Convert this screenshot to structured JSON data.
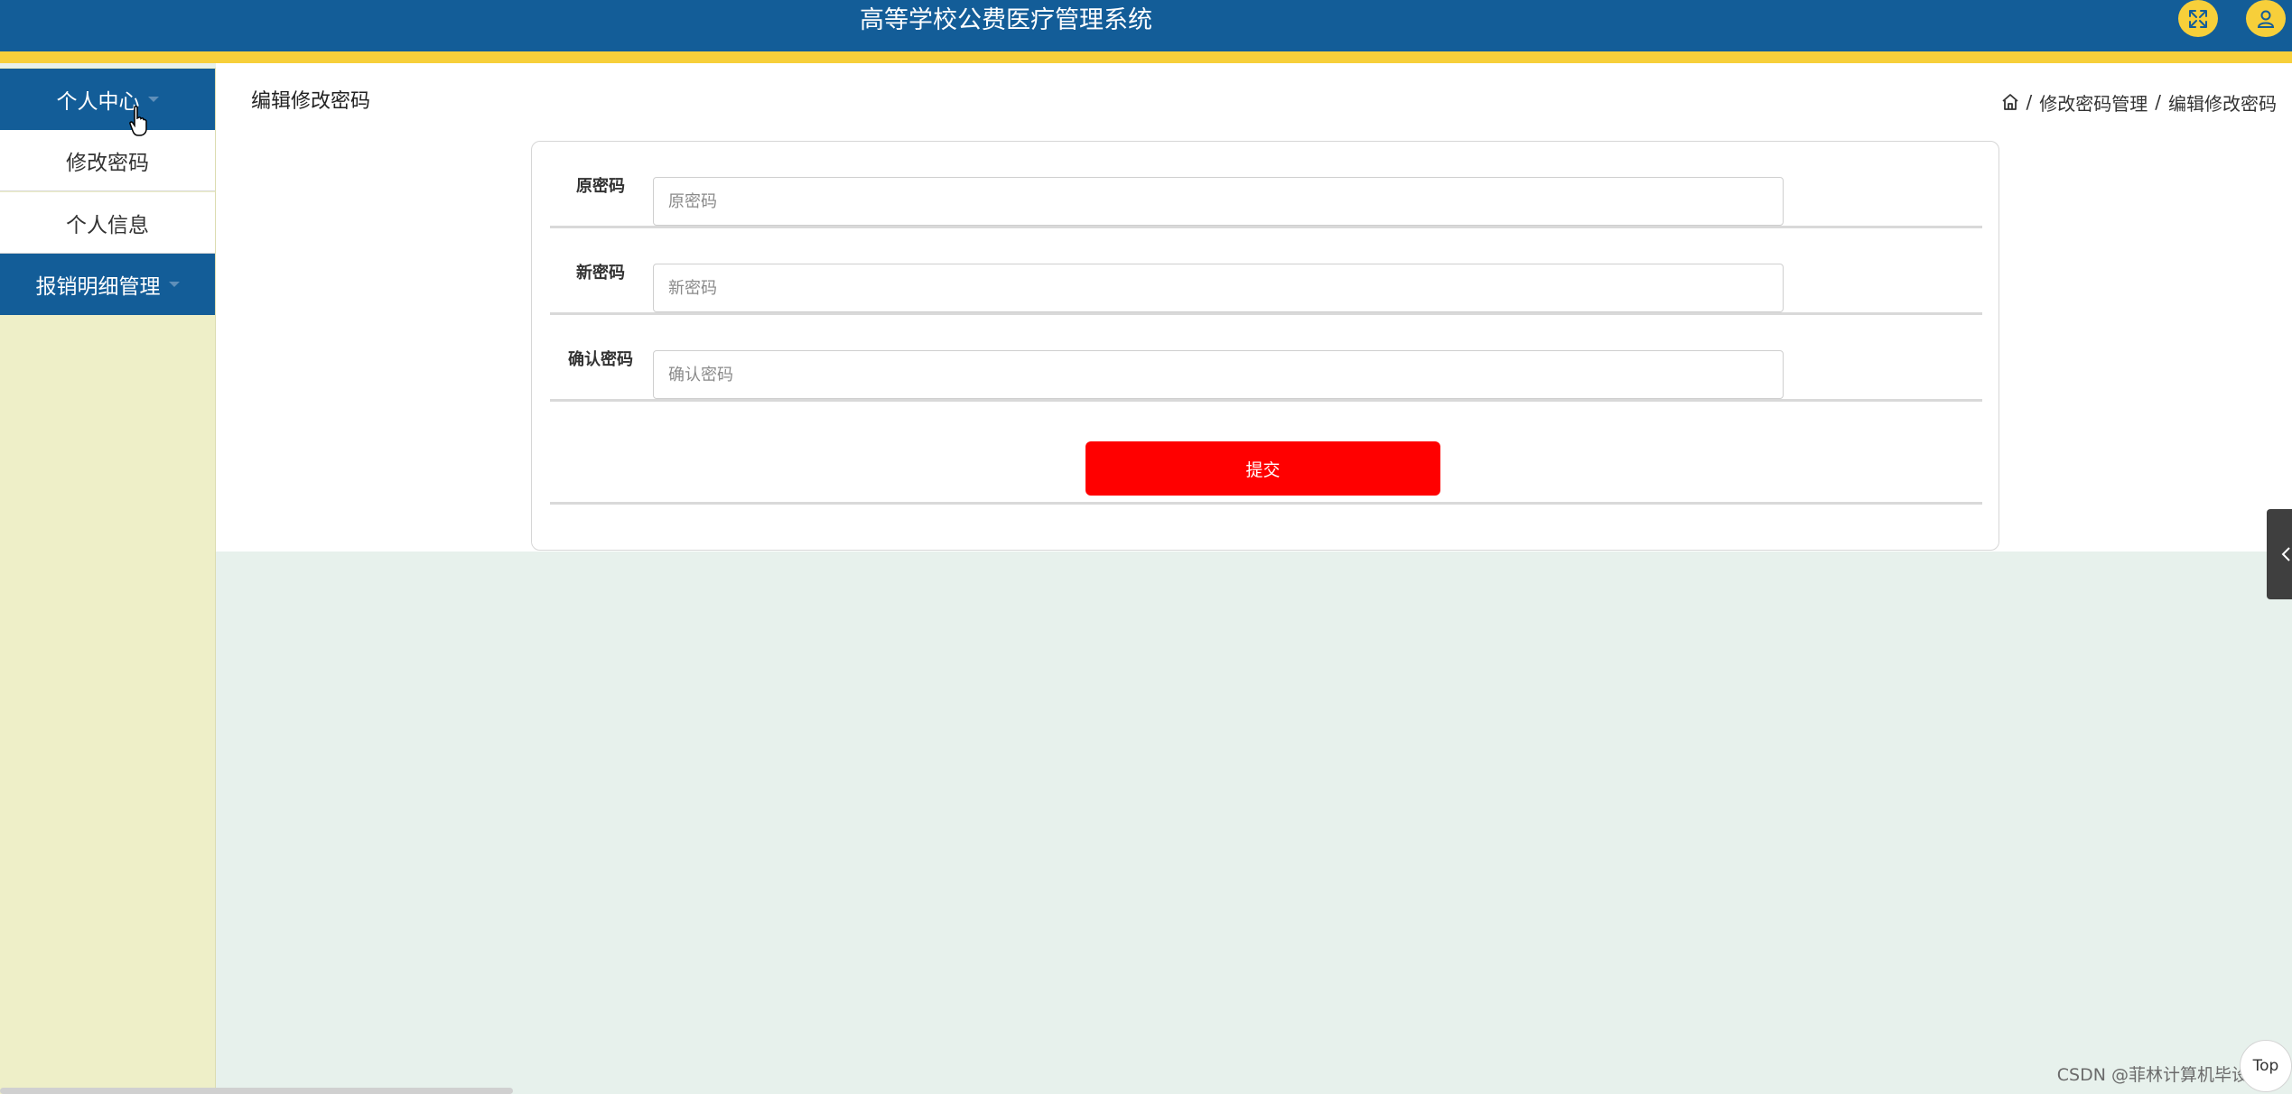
{
  "header": {
    "title": "高等学校公费医疗管理系统",
    "fullscreen_icon": "expand-icon",
    "user_icon": "user-icon",
    "accent_color": "#f7cf3a",
    "bar_color": "#135d98"
  },
  "sidebar": {
    "groups": [
      {
        "label": "个人中心",
        "expanded": true,
        "items": [
          {
            "label": "修改密码"
          },
          {
            "label": "个人信息"
          }
        ]
      },
      {
        "label": "报销明细管理",
        "expanded": false,
        "items": []
      }
    ]
  },
  "main": {
    "page_title": "编辑修改密码",
    "breadcrumb": {
      "home_icon": "home-icon",
      "items": [
        "修改密码管理",
        "编辑修改密码"
      ],
      "separator": "/"
    },
    "form": {
      "fields": [
        {
          "label": "原密码",
          "placeholder": "原密码",
          "value": ""
        },
        {
          "label": "新密码",
          "placeholder": "新密码",
          "value": ""
        },
        {
          "label": "确认密码",
          "placeholder": "确认密码",
          "value": ""
        }
      ],
      "submit_label": "提交",
      "submit_color": "#ff0000"
    }
  },
  "overlay": {
    "top_button_label": "Top",
    "watermark": "CSDN @菲林计算机毕设"
  }
}
